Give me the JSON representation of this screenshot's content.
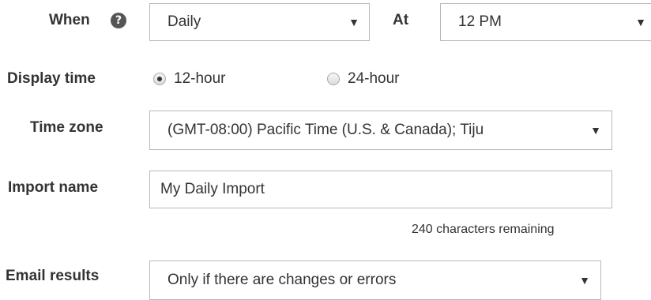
{
  "schedule": {
    "when": {
      "label": "When",
      "help_icon": "question-circle-icon",
      "help_glyph": "?",
      "value": "Daily"
    },
    "at": {
      "label": "At",
      "value": "12 PM"
    },
    "caret_glyph": "▼"
  },
  "display_time": {
    "label": "Display time",
    "options": [
      {
        "label": "12-hour",
        "checked": true
      },
      {
        "label": "24-hour",
        "checked": false
      }
    ]
  },
  "time_zone": {
    "label": "Time zone",
    "value": "(GMT-08:00) Pacific Time (U.S. & Canada); Tiju"
  },
  "import_name": {
    "label": "Import name",
    "value": "My Daily Import",
    "remaining": "240 characters remaining"
  },
  "email_results": {
    "label": "Email results",
    "value": "Only if there are changes or errors"
  }
}
